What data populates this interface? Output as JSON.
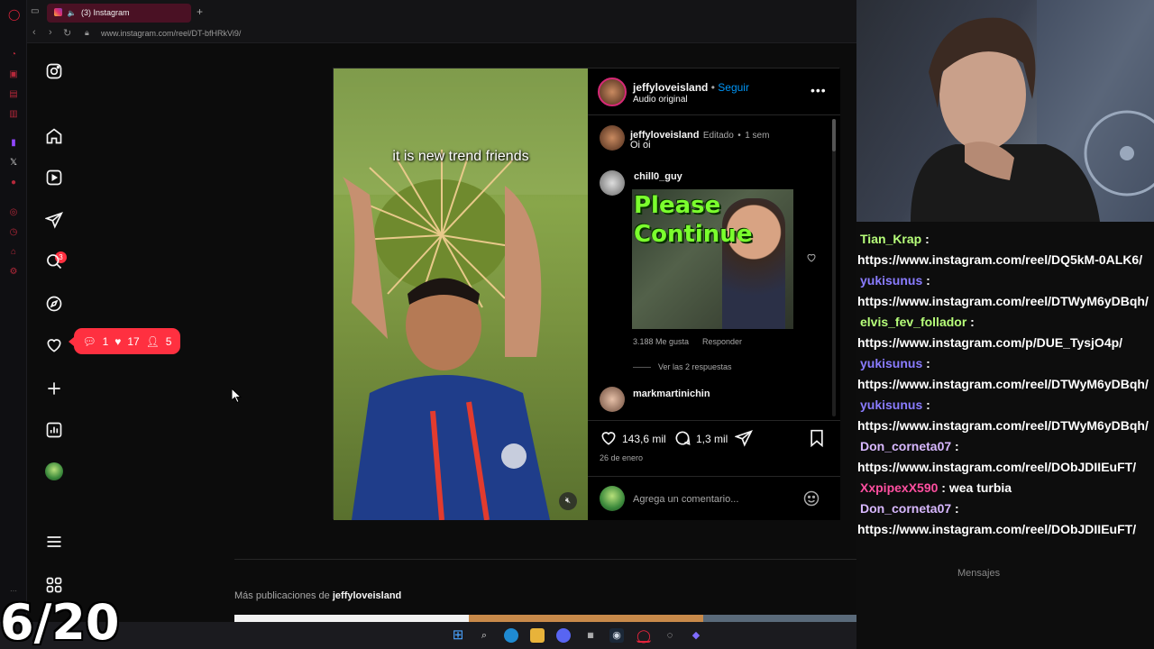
{
  "browser": {
    "tab_title": "(3) Instagram",
    "url": "www.instagram.com/reel/DT-bfHRkVi9/"
  },
  "nav": {
    "direct_badge": "3",
    "notif_comments": "1",
    "notif_likes": "17",
    "notif_follows": "5"
  },
  "post": {
    "caption_overlay": "it is new trend friends",
    "author": "jeffyloveisland",
    "follow_label": "Seguir",
    "audio": "Audio original",
    "author_comment": {
      "user": "jeffyloveisland",
      "edited": "Editado",
      "time": "1 sem",
      "text": "Oi oi"
    },
    "comments": [
      {
        "user": "chill0_guy",
        "gif_text": "Please Continue",
        "likes": "3.188 Me gusta",
        "reply": "Responder",
        "view_replies": "Ver las 2 respuestas"
      },
      {
        "user": "markmartinichin"
      }
    ],
    "like_count": "143,6 mil",
    "comment_count": "1,3 mil",
    "date": "26 de enero",
    "comment_placeholder": "Agrega un comentario..."
  },
  "more_posts": {
    "prefix": "Más publicaciones de",
    "user": "jeffyloveisland"
  },
  "chat": [
    {
      "user": "Tian_Krap",
      "color": "#b7ff7a",
      "msg": "https://www.instagram.com/reel/DQ5kM-0ALK6/"
    },
    {
      "user": "yukisunus",
      "color": "#8a7cff",
      "msg": "https://www.instagram.com/reel/DTWyM6yDBqh/"
    },
    {
      "user": "elvis_fev_follador",
      "color": "#b7ff7a",
      "msg": "https://www.instagram.com/p/DUE_TysjO4p/"
    },
    {
      "user": "yukisunus",
      "color": "#8a7cff",
      "msg": "https://www.instagram.com/reel/DTWyM6yDBqh/"
    },
    {
      "user": "yukisunus",
      "color": "#8a7cff",
      "msg": "https://www.instagram.com/reel/DTWyM6yDBqh/"
    },
    {
      "user": "Don_corneta07",
      "color": "#d8b8ff",
      "msg": "https://www.instagram.com/reel/DObJDIIEuFT/"
    },
    {
      "user": "XxpipexX590",
      "color": "#ff4fa0",
      "msg": "wea turbia"
    },
    {
      "user": "Don_corneta07",
      "color": "#d8b8ff",
      "msg": "https://www.instagram.com/reel/DObJDIIEuFT/"
    }
  ],
  "chat_overlay": "Mensajes",
  "counter": "6/20",
  "colors": {
    "accent_follow": "#0095f6",
    "notification_red": "#ff3040",
    "opera_tab": "#4a1124"
  }
}
